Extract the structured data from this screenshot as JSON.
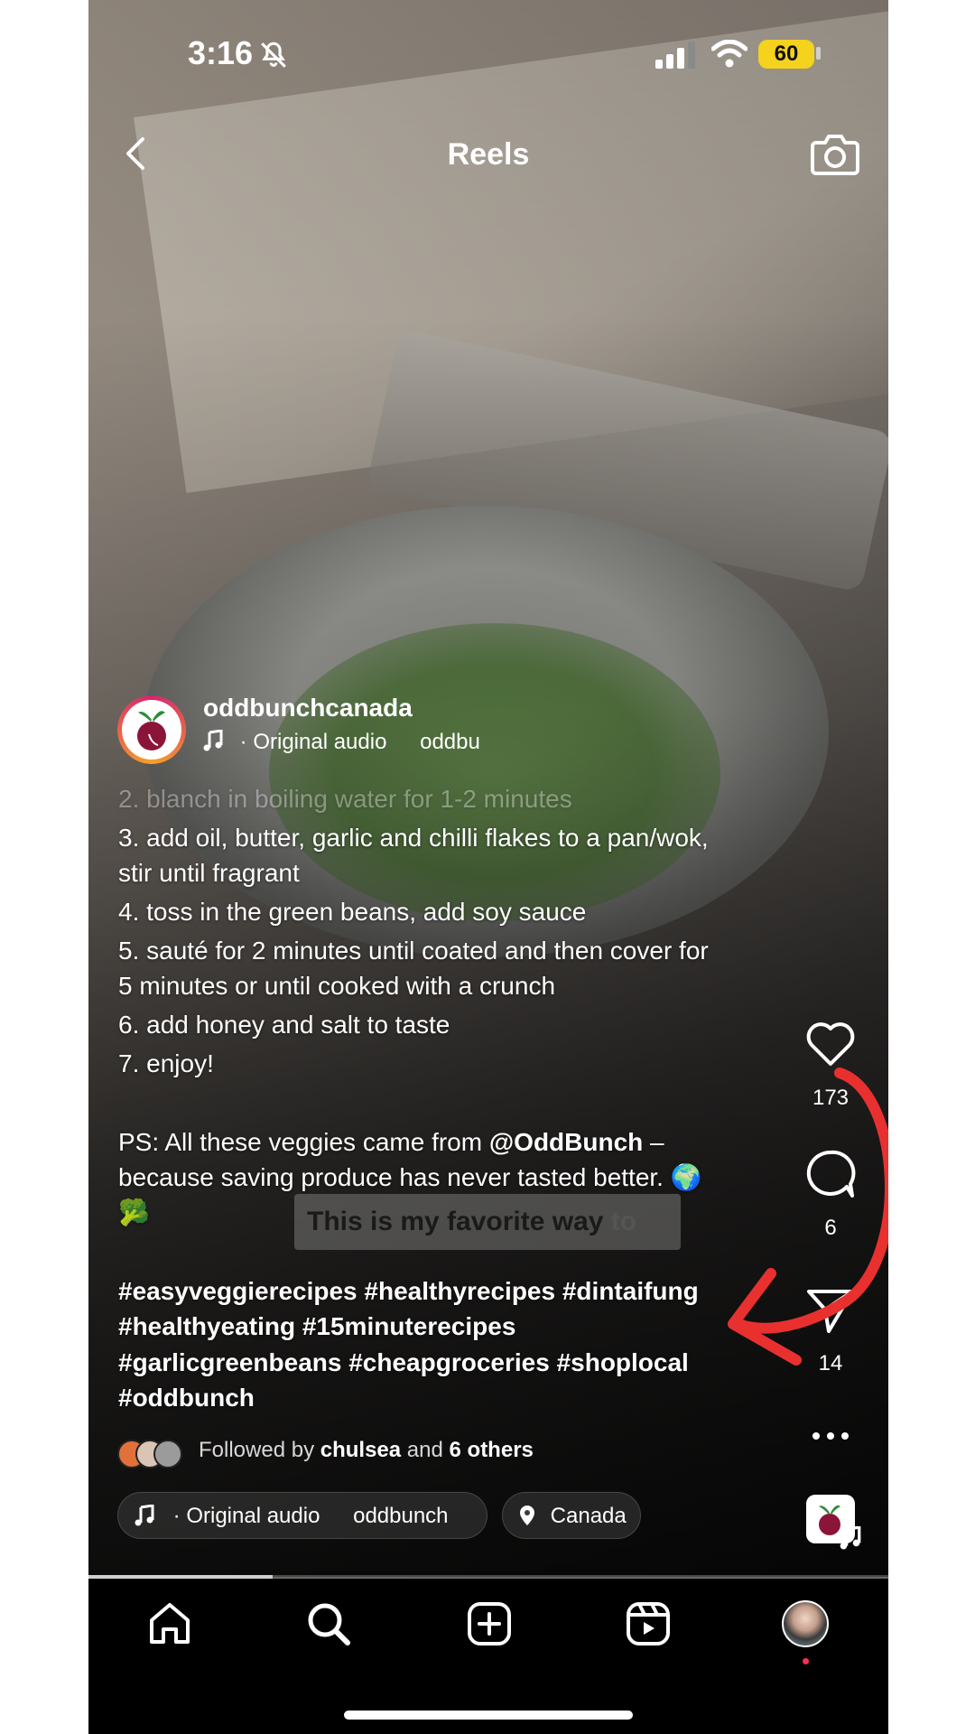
{
  "status_bar": {
    "time": "3:16",
    "battery": "60"
  },
  "header": {
    "title": "Reels"
  },
  "post": {
    "username": "oddbunchcanada",
    "audio_label": "· Original audio",
    "audio_author": "oddbu",
    "caption_lines": [
      "2. blanch in boiling water for 1-2 minutes",
      "3. add oil, butter, garlic and chilli flakes to a pan/wok,",
      "stir until fragrant",
      "4. toss in the green beans, add soy sauce",
      "5. sauté for 2 minutes until coated and then cover for",
      "5 minutes or until cooked with a crunch",
      "6. add honey and salt to taste",
      "7. enjoy!"
    ],
    "ps_prefix": "PS: All these veggies came from",
    "ps_mention": "@OddBunch",
    "ps_suffix": " –",
    "ps_line2": "because saving produce has never tasted better. 🌍",
    "ps_line3": "🥦",
    "hashtag_lines": [
      "#easyveggierecipes #healthyrecipes #dintaifung",
      "#healthyeating #15minuterecipes",
      "#garlicgreenbeans #cheapgroceries #shoplocal",
      "#oddbunch"
    ],
    "sticker_text": "This is my favorite way",
    "sticker_text_dim": " to",
    "followed_by_prefix": "Followed by",
    "followed_by_user": "chulsea",
    "followed_by_and": "and",
    "followed_by_others": "6 others",
    "chip_audio_label": "· Original audio",
    "chip_audio_author": "oddbunch",
    "chip_location": "Canada",
    "video_progress": 0.23
  },
  "actions": {
    "likes": "173",
    "comments": "6",
    "shares": "14"
  },
  "icons": [
    "bell-slash-icon",
    "signal-icon",
    "wifi-icon",
    "back-icon",
    "camera-icon",
    "music-note-icon",
    "heart-icon",
    "comment-icon",
    "send-icon",
    "more-icon",
    "location-pin-icon",
    "home-icon",
    "search-icon",
    "create-icon",
    "reels-icon"
  ],
  "colors": {
    "annotation_arrow": "#e8312f",
    "battery": "#f4d21d",
    "notification_dot": "#ff2d55"
  }
}
